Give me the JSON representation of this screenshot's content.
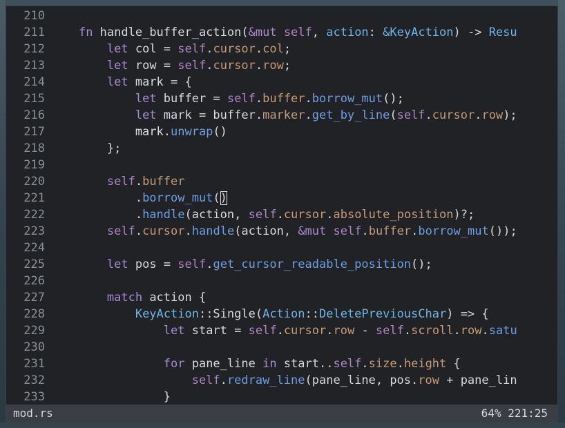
{
  "colors": {
    "keyword": "#a98ad6",
    "self": "#b084c6",
    "field": "#c79a7a",
    "method": "#6e9ee6",
    "type": "#6fb4e8",
    "text": "#d8dadf",
    "line_number": "#8a8f98"
  },
  "editor": {
    "lines": [
      {
        "num": "210",
        "tokens": []
      },
      {
        "num": "211",
        "tokens": [
          {
            "t": "    "
          },
          {
            "t": "fn",
            "c": "keyword"
          },
          {
            "t": " handle_buffer_action("
          },
          {
            "t": "&mut",
            "c": "keyword"
          },
          {
            "t": " "
          },
          {
            "t": "self",
            "c": "self"
          },
          {
            "t": ", "
          },
          {
            "t": "action",
            "c": "type"
          },
          {
            "t": ": "
          },
          {
            "t": "&KeyAction",
            "c": "type"
          },
          {
            "t": ") -> "
          },
          {
            "t": "Resu",
            "c": "type"
          }
        ]
      },
      {
        "num": "212",
        "tokens": [
          {
            "t": "        "
          },
          {
            "t": "let",
            "c": "keyword"
          },
          {
            "t": " col = "
          },
          {
            "t": "self",
            "c": "self"
          },
          {
            "t": "."
          },
          {
            "t": "cursor",
            "c": "field"
          },
          {
            "t": "."
          },
          {
            "t": "col",
            "c": "field"
          },
          {
            "t": ";"
          }
        ]
      },
      {
        "num": "213",
        "tokens": [
          {
            "t": "        "
          },
          {
            "t": "let",
            "c": "keyword"
          },
          {
            "t": " row = "
          },
          {
            "t": "self",
            "c": "self"
          },
          {
            "t": "."
          },
          {
            "t": "cursor",
            "c": "field"
          },
          {
            "t": "."
          },
          {
            "t": "row",
            "c": "field"
          },
          {
            "t": ";"
          }
        ]
      },
      {
        "num": "214",
        "tokens": [
          {
            "t": "        "
          },
          {
            "t": "let",
            "c": "keyword"
          },
          {
            "t": " mark = {"
          }
        ]
      },
      {
        "num": "215",
        "tokens": [
          {
            "t": "            "
          },
          {
            "t": "let",
            "c": "keyword"
          },
          {
            "t": " buffer = "
          },
          {
            "t": "self",
            "c": "self"
          },
          {
            "t": "."
          },
          {
            "t": "buffer",
            "c": "field"
          },
          {
            "t": "."
          },
          {
            "t": "borrow_mut",
            "c": "method"
          },
          {
            "t": "();"
          }
        ]
      },
      {
        "num": "216",
        "tokens": [
          {
            "t": "            "
          },
          {
            "t": "let",
            "c": "keyword"
          },
          {
            "t": " mark = buffer."
          },
          {
            "t": "marker",
            "c": "field"
          },
          {
            "t": "."
          },
          {
            "t": "get_by_line",
            "c": "method"
          },
          {
            "t": "("
          },
          {
            "t": "self",
            "c": "self"
          },
          {
            "t": "."
          },
          {
            "t": "cursor",
            "c": "field"
          },
          {
            "t": "."
          },
          {
            "t": "row",
            "c": "field"
          },
          {
            "t": ");"
          }
        ]
      },
      {
        "num": "217",
        "tokens": [
          {
            "t": "            mark."
          },
          {
            "t": "unwrap",
            "c": "method"
          },
          {
            "t": "()"
          }
        ]
      },
      {
        "num": "218",
        "tokens": [
          {
            "t": "        };"
          }
        ]
      },
      {
        "num": "219",
        "tokens": []
      },
      {
        "num": "220",
        "tokens": [
          {
            "t": "        "
          },
          {
            "t": "self",
            "c": "self"
          },
          {
            "t": "."
          },
          {
            "t": "buffer",
            "c": "field"
          }
        ]
      },
      {
        "num": "221",
        "tokens": [
          {
            "t": "            ."
          },
          {
            "t": "borrow_mut",
            "c": "method"
          },
          {
            "t": "("
          },
          {
            "t": ")",
            "cursor": true
          }
        ]
      },
      {
        "num": "222",
        "tokens": [
          {
            "t": "            ."
          },
          {
            "t": "handle",
            "c": "method"
          },
          {
            "t": "(action, "
          },
          {
            "t": "self",
            "c": "self"
          },
          {
            "t": "."
          },
          {
            "t": "cursor",
            "c": "field"
          },
          {
            "t": "."
          },
          {
            "t": "absolute_position",
            "c": "field"
          },
          {
            "t": ")?;"
          }
        ]
      },
      {
        "num": "223",
        "tokens": [
          {
            "t": "        "
          },
          {
            "t": "self",
            "c": "self"
          },
          {
            "t": "."
          },
          {
            "t": "cursor",
            "c": "field"
          },
          {
            "t": "."
          },
          {
            "t": "handle",
            "c": "method"
          },
          {
            "t": "(action, "
          },
          {
            "t": "&mut",
            "c": "keyword"
          },
          {
            "t": " "
          },
          {
            "t": "self",
            "c": "self"
          },
          {
            "t": "."
          },
          {
            "t": "buffer",
            "c": "field"
          },
          {
            "t": "."
          },
          {
            "t": "borrow_mut",
            "c": "method"
          },
          {
            "t": "());"
          }
        ]
      },
      {
        "num": "224",
        "tokens": []
      },
      {
        "num": "225",
        "tokens": [
          {
            "t": "        "
          },
          {
            "t": "let",
            "c": "keyword"
          },
          {
            "t": " pos = "
          },
          {
            "t": "self",
            "c": "self"
          },
          {
            "t": "."
          },
          {
            "t": "get_cursor_readable_position",
            "c": "method"
          },
          {
            "t": "();"
          }
        ]
      },
      {
        "num": "226",
        "tokens": []
      },
      {
        "num": "227",
        "tokens": [
          {
            "t": "        "
          },
          {
            "t": "match",
            "c": "keyword"
          },
          {
            "t": " action {"
          }
        ]
      },
      {
        "num": "228",
        "tokens": [
          {
            "t": "            "
          },
          {
            "t": "KeyAction",
            "c": "type"
          },
          {
            "t": "::Single("
          },
          {
            "t": "Action",
            "c": "type"
          },
          {
            "t": "::"
          },
          {
            "t": "DeletePreviousChar",
            "c": "type"
          },
          {
            "t": ") => {"
          }
        ]
      },
      {
        "num": "229",
        "tokens": [
          {
            "t": "                "
          },
          {
            "t": "let",
            "c": "keyword"
          },
          {
            "t": " start = "
          },
          {
            "t": "self",
            "c": "self"
          },
          {
            "t": "."
          },
          {
            "t": "cursor",
            "c": "field"
          },
          {
            "t": "."
          },
          {
            "t": "row",
            "c": "field"
          },
          {
            "t": " - "
          },
          {
            "t": "self",
            "c": "self"
          },
          {
            "t": "."
          },
          {
            "t": "scroll",
            "c": "field"
          },
          {
            "t": "."
          },
          {
            "t": "row",
            "c": "field"
          },
          {
            "t": "."
          },
          {
            "t": "satu",
            "c": "method"
          }
        ]
      },
      {
        "num": "230",
        "tokens": []
      },
      {
        "num": "231",
        "tokens": [
          {
            "t": "                "
          },
          {
            "t": "for",
            "c": "keyword"
          },
          {
            "t": " pane_line "
          },
          {
            "t": "in",
            "c": "keyword"
          },
          {
            "t": " start.."
          },
          {
            "t": "self",
            "c": "self"
          },
          {
            "t": "."
          },
          {
            "t": "size",
            "c": "field"
          },
          {
            "t": "."
          },
          {
            "t": "height",
            "c": "field"
          },
          {
            "t": " {"
          }
        ]
      },
      {
        "num": "232",
        "tokens": [
          {
            "t": "                    "
          },
          {
            "t": "self",
            "c": "self"
          },
          {
            "t": "."
          },
          {
            "t": "redraw_line",
            "c": "method"
          },
          {
            "t": "(pane_line, pos."
          },
          {
            "t": "row",
            "c": "field"
          },
          {
            "t": " + pane_lin"
          }
        ]
      },
      {
        "num": "233",
        "tokens": [
          {
            "t": "                }"
          }
        ]
      }
    ]
  },
  "statusbar": {
    "filename": "mod.rs",
    "position": "64% 221:25"
  }
}
